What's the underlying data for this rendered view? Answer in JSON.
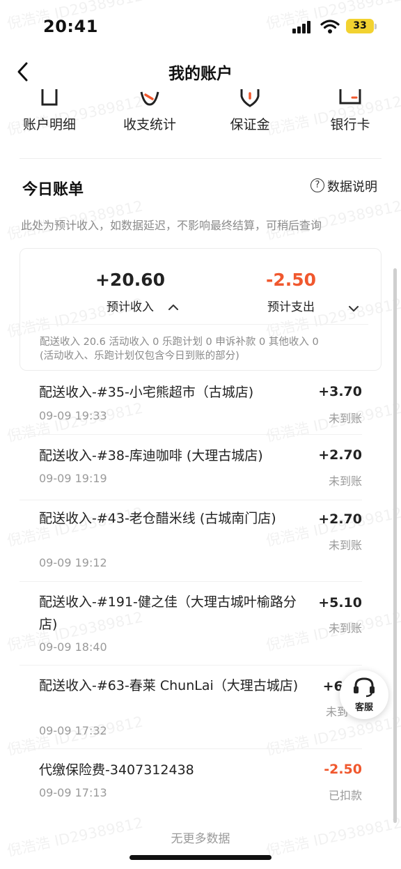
{
  "status_bar": {
    "time": "20:41",
    "battery": "33",
    "icons": [
      "signal-icon",
      "wifi-icon",
      "battery-icon"
    ]
  },
  "nav": {
    "title": "我的账户",
    "back_icon": "chevron-left-icon"
  },
  "shortcuts": [
    {
      "label": "账户明细",
      "icon": "document-icon"
    },
    {
      "label": "收支统计",
      "icon": "chart-icon"
    },
    {
      "label": "保证金",
      "icon": "shield-icon"
    },
    {
      "label": "银行卡",
      "icon": "card-icon"
    }
  ],
  "today": {
    "title": "今日账单",
    "data_explain": "数据说明",
    "notice": "此处为预计收入，如数据延迟，不影响最终结算，可稍后查询"
  },
  "summary": {
    "income_amount": "+20.60",
    "income_label": "预计收入",
    "expense_amount": "-2.50",
    "expense_label": "预计支出",
    "breakdown_line1": "配送收入 20.6 活动收入 0 乐跑计划 0 申诉补款 0 其他收入 0",
    "breakdown_line2": "(活动收入、乐跑计划仅包含今日到账的部分)"
  },
  "records": [
    {
      "title": "配送收入-#35-小宅熊超市（古城店)",
      "time": "09-09 19:33",
      "amount": "+3.70",
      "status": "未到账"
    },
    {
      "title": "配送收入-#38-库迪咖啡 (大理古城店)",
      "time": "09-09 19:19",
      "amount": "+2.70",
      "status": "未到账"
    },
    {
      "title": "配送收入-#43-老仓醋米线 (古城南门店)",
      "time": "09-09 19:12",
      "amount": "+2.70",
      "status": "未到账"
    },
    {
      "title": "配送收入-#191-健之佳（大理古城叶榆路分店)",
      "time": "09-09 18:40",
      "amount": "+5.10",
      "status": "未到账"
    },
    {
      "title": "配送收入-#63-春莱 ChunLai（大理古城店)",
      "time": "09-09 17:32",
      "amount": "+6.",
      "status": "未到"
    },
    {
      "title": "代缴保险费-3407312438",
      "time": "09-09 17:13",
      "amount": "-2.50",
      "status": "已扣款"
    }
  ],
  "footer": {
    "no_more": "无更多数据"
  },
  "service_button": {
    "label": "客服",
    "icon": "headset-icon"
  },
  "watermark": "倪浩浩 ID29389812",
  "colors": {
    "expense_red": "#f0582e",
    "text_primary": "#222222",
    "text_secondary": "#9a9a9a",
    "battery_yellow": "#f2d230"
  }
}
